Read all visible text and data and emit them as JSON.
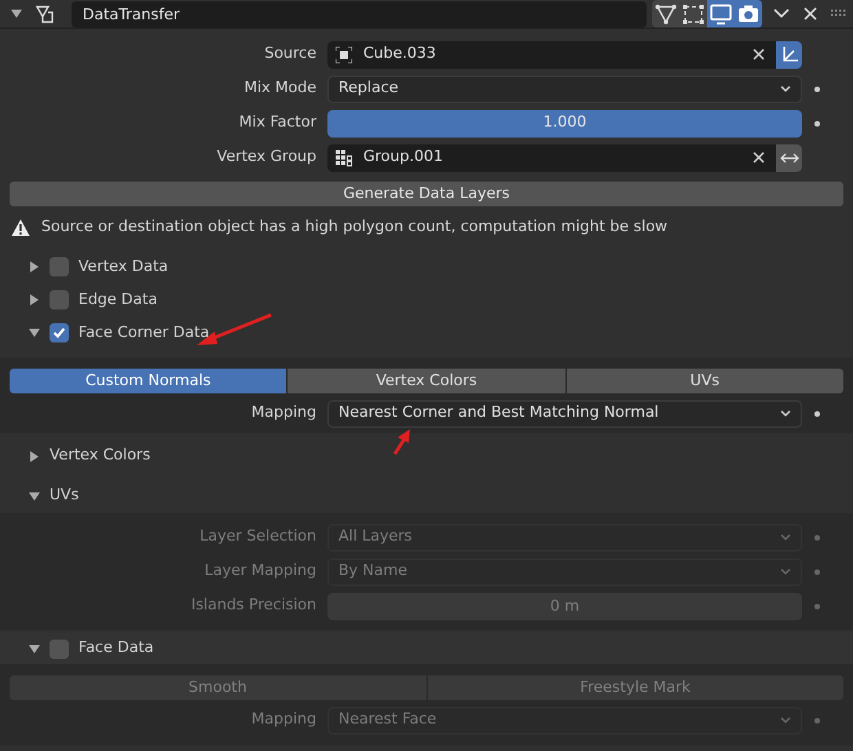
{
  "header": {
    "expanded": true,
    "name": "DataTransfer",
    "toggles": [
      {
        "kind": "triangle",
        "on": false
      },
      {
        "kind": "vertices",
        "on": false
      },
      {
        "kind": "monitor",
        "on": true
      },
      {
        "kind": "camera",
        "on": true
      }
    ]
  },
  "fields": [
    {
      "label": "Source",
      "kind": "object",
      "value": "Cube.033",
      "keyframe_dot": false,
      "disabled": false
    },
    {
      "label": "Mix Mode",
      "kind": "dropdown",
      "value": "Replace",
      "keyframe_dot": true,
      "disabled": false
    },
    {
      "label": "Mix Factor",
      "kind": "slider",
      "value": "1.000",
      "level": 1,
      "keyframe_dot": true,
      "disabled": false
    },
    {
      "label": "Vertex Group",
      "kind": "group",
      "value": "Group.001",
      "keyframe_dot": false,
      "disabled": false
    }
  ],
  "generate_button": "Generate Data Layers",
  "warning": "Source or destination object has a high polygon count, computation might be slow",
  "data_sections": [
    {
      "label": "Vertex Data",
      "expanded": false,
      "checked": false
    },
    {
      "label": "Edge Data",
      "expanded": false,
      "checked": false
    },
    {
      "label": "Face Corner Data",
      "expanded": true,
      "checked": true
    }
  ],
  "face_corner": {
    "tabs": [
      {
        "label": "Custom Normals",
        "selected": true
      },
      {
        "label": "Vertex Colors",
        "selected": false
      },
      {
        "label": "UVs",
        "selected": false
      }
    ],
    "fields": [
      {
        "label": "Mapping",
        "kind": "dropdown",
        "value": "Nearest Corner and Best Matching Normal",
        "keyframe_dot": true,
        "disabled": false
      }
    ]
  },
  "subpanels": [
    {
      "label": "Vertex Colors",
      "expanded": false
    },
    {
      "label": "UVs",
      "expanded": true,
      "fields": [
        {
          "label": "Layer Selection",
          "kind": "dropdown",
          "value": "All Layers",
          "keyframe_dot": true,
          "disabled": true
        },
        {
          "label": "Layer Mapping",
          "kind": "dropdown",
          "value": "By Name",
          "keyframe_dot": true,
          "disabled": true
        },
        {
          "label": "Islands Precision",
          "kind": "number",
          "value": "0 m",
          "keyframe_dot": true,
          "disabled": true
        }
      ]
    }
  ],
  "face_data": {
    "label": "Face Data",
    "expanded": true,
    "checked": false,
    "tabs": [
      {
        "label": "Smooth",
        "selected": false,
        "disabled": true
      },
      {
        "label": "Freestyle Mark",
        "selected": false,
        "disabled": true
      }
    ],
    "fields": [
      {
        "label": "Mapping",
        "kind": "dropdown",
        "value": "Nearest Face",
        "keyframe_dot": true,
        "disabled": true
      }
    ]
  }
}
